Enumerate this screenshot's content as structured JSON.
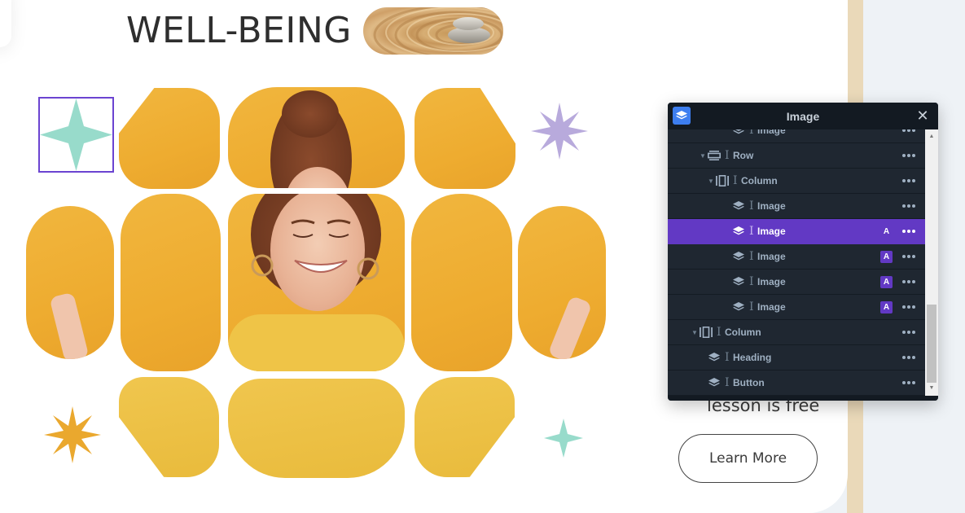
{
  "page": {
    "headline": "WELL-BEING",
    "cta_text": "lesson is free",
    "cta_button": "Learn More"
  },
  "colors": {
    "accent_purple": "#6239c4",
    "panel_bg": "#1f2731",
    "panel_header_bg": "#131a22",
    "logo_blue": "#3d7ef0",
    "mint_star": "#98dbcb",
    "lavender_star": "#b8aadc",
    "gold_star": "#eaa82e",
    "tile_yellow": "#f0b23a"
  },
  "layers_panel": {
    "title": "Image",
    "logo_icon": "layers-icon",
    "close_icon": "close-icon",
    "rows": [
      {
        "label": "Image",
        "type": "image",
        "depth": 3,
        "expandable": false,
        "badge": "",
        "active": false
      },
      {
        "label": "Row",
        "type": "row",
        "depth": 1,
        "expandable": true,
        "badge": "",
        "active": false
      },
      {
        "label": "Column",
        "type": "column",
        "depth": 2,
        "expandable": true,
        "badge": "",
        "active": false
      },
      {
        "label": "Image",
        "type": "image",
        "depth": 3,
        "expandable": false,
        "badge": "",
        "active": false
      },
      {
        "label": "Image",
        "type": "image",
        "depth": 3,
        "expandable": false,
        "badge": "A",
        "active": true
      },
      {
        "label": "Image",
        "type": "image",
        "depth": 3,
        "expandable": false,
        "badge": "A",
        "active": false
      },
      {
        "label": "Image",
        "type": "image",
        "depth": 3,
        "expandable": false,
        "badge": "A",
        "active": false
      },
      {
        "label": "Image",
        "type": "image",
        "depth": 3,
        "expandable": false,
        "badge": "A",
        "active": false
      },
      {
        "label": "Column",
        "type": "column",
        "depth": 0,
        "expandable": true,
        "badge": "",
        "active": false
      },
      {
        "label": "Heading",
        "type": "image",
        "depth": 1,
        "expandable": false,
        "badge": "",
        "active": false
      },
      {
        "label": "Button",
        "type": "image",
        "depth": 1,
        "expandable": false,
        "badge": "",
        "active": false
      }
    ]
  }
}
